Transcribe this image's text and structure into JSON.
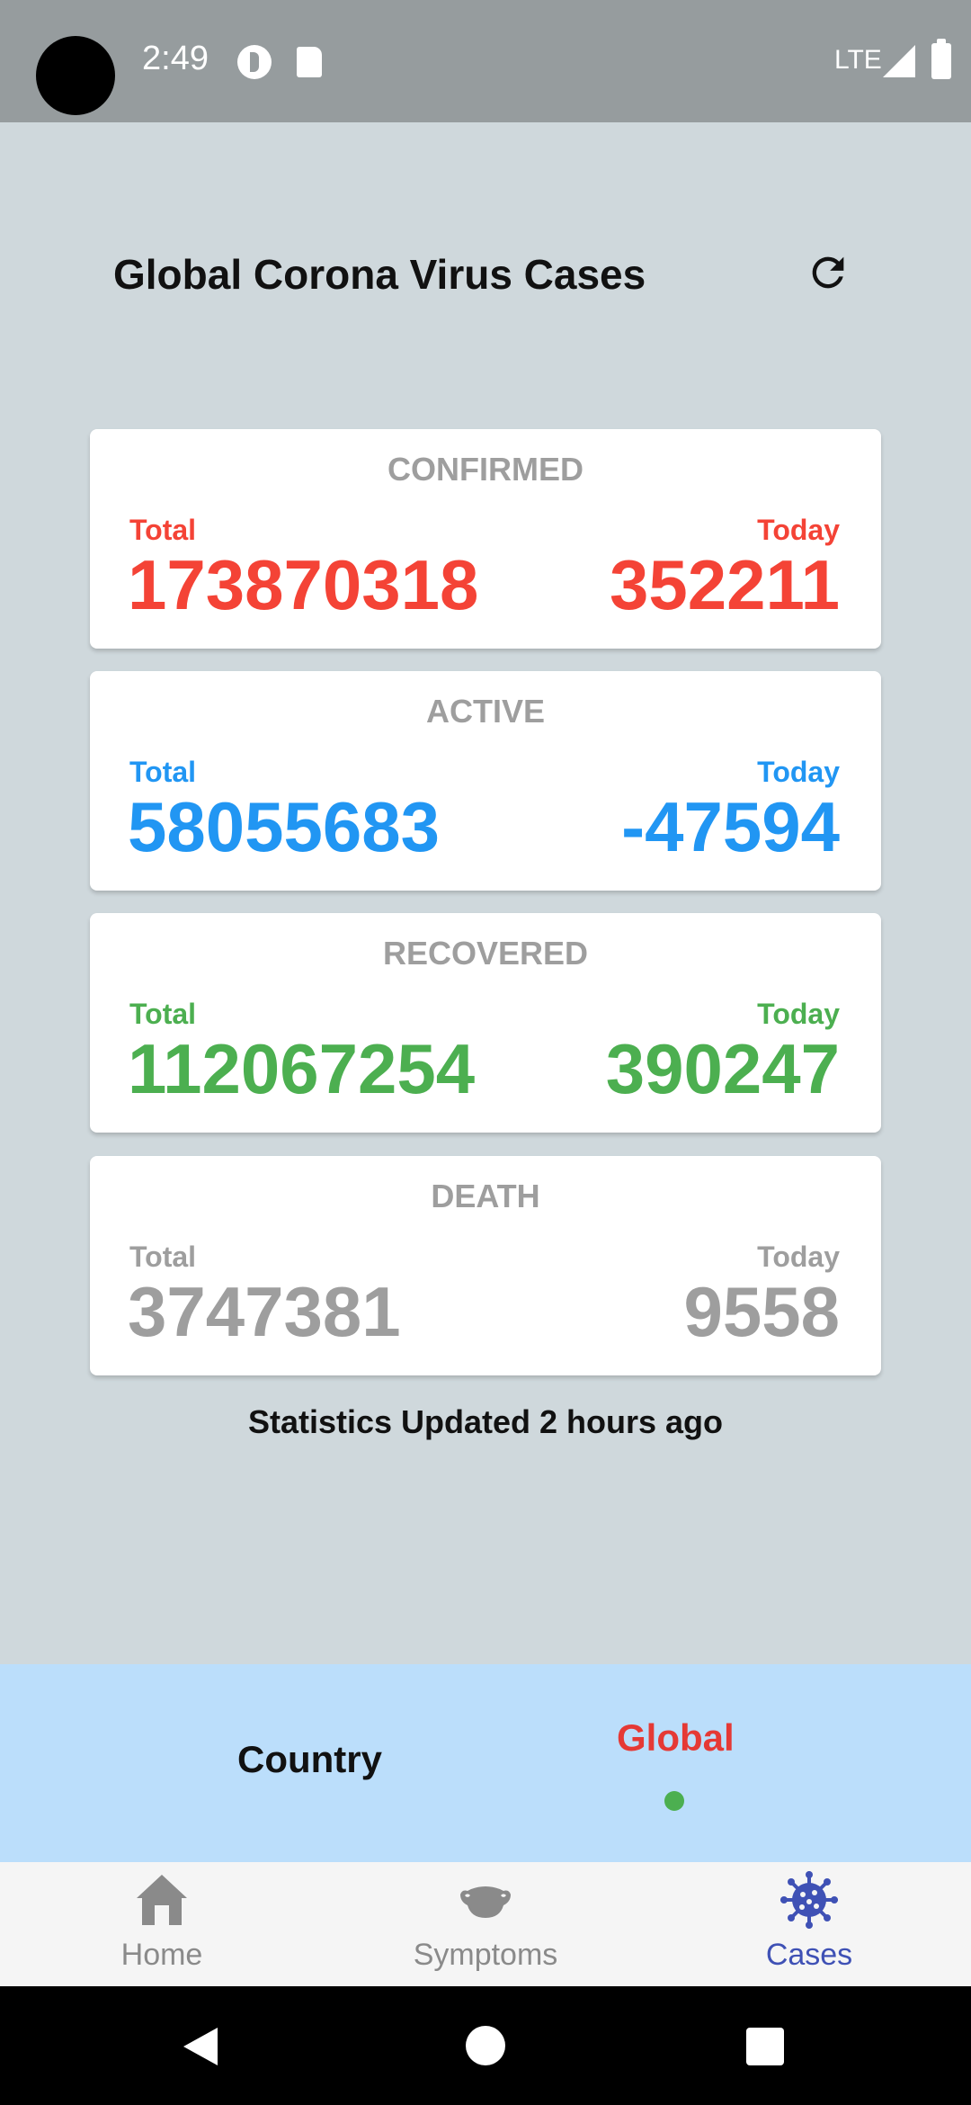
{
  "status_bar": {
    "time": "2:49",
    "network": "LTE"
  },
  "header": {
    "title": "Global Corona Virus Cases",
    "refresh_icon": "refresh-icon"
  },
  "cards": [
    {
      "title": "CONFIRMED",
      "total_label": "Total",
      "today_label": "Today",
      "total": "173870318",
      "today": "352211",
      "color": "#f44336"
    },
    {
      "title": "ACTIVE",
      "total_label": "Total",
      "today_label": "Today",
      "total": "58055683",
      "today": "-47594",
      "color": "#2196f3"
    },
    {
      "title": "RECOVERED",
      "total_label": "Total",
      "today_label": "Today",
      "total": "112067254",
      "today": "390247",
      "color": "#4caf50"
    },
    {
      "title": "DEATH",
      "total_label": "Total",
      "today_label": "Today",
      "total": "3747381",
      "today": "9558",
      "color": "#9e9e9e"
    }
  ],
  "updated": "Statistics Updated 2 hours ago",
  "tabs": {
    "country": "Country",
    "global": "Global",
    "active_tab": "Global",
    "active_color": "#e53935",
    "indicator_color": "#4caf50"
  },
  "bottom_nav": {
    "items": [
      {
        "label": "Home",
        "icon": "home-icon"
      },
      {
        "label": "Symptoms",
        "icon": "mask-icon"
      },
      {
        "label": "Cases",
        "icon": "virus-icon"
      }
    ],
    "selected": "Cases",
    "selected_color": "#3f51b5",
    "inactive_color": "#8a8a8a"
  }
}
